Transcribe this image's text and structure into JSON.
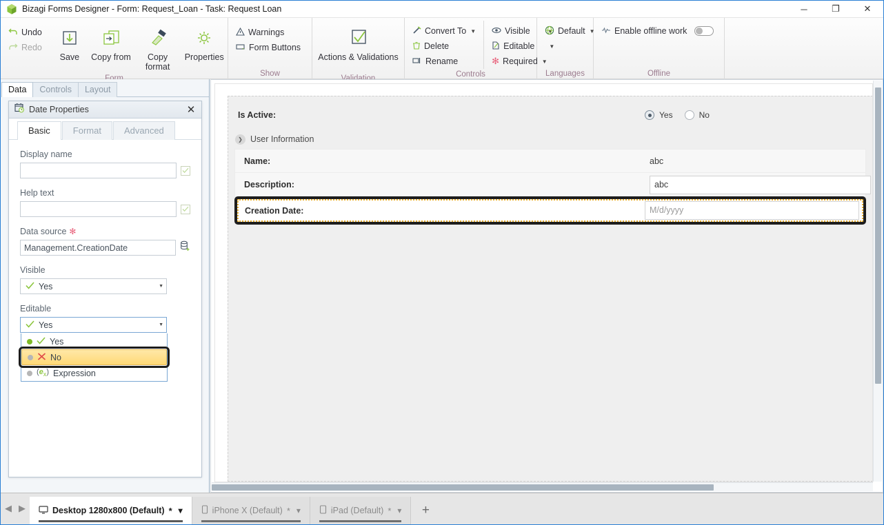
{
  "window": {
    "title": "Bizagi Forms Designer  - Form: Request_Loan - Task:  Request Loan",
    "logo_icon": "bizagi-cube-icon",
    "minimize_label": "─",
    "maximize_label": "❐",
    "close_label": "✕"
  },
  "ribbon": {
    "groups": [
      {
        "label": "Form",
        "small_commands": [
          {
            "label": "Undo",
            "icon": "undo-icon",
            "disabled": false
          },
          {
            "label": "Redo",
            "icon": "redo-icon",
            "disabled": true
          }
        ],
        "big_commands": [
          {
            "label": "Save",
            "icon": "save-icon"
          },
          {
            "label": "Copy from",
            "icon": "copy-from-icon"
          },
          {
            "label": "Copy format",
            "icon": "copy-format-icon"
          },
          {
            "label": "Properties",
            "icon": "gear-icon"
          }
        ]
      },
      {
        "label": "Show",
        "small_commands": [
          {
            "label": "Warnings",
            "icon": "warning-triangle-icon"
          },
          {
            "label": "Form Buttons",
            "icon": "form-buttons-icon"
          }
        ]
      },
      {
        "label": "Validation",
        "big_commands": [
          {
            "label": "Actions & Validations",
            "icon": "checkmark-box-icon"
          }
        ]
      },
      {
        "label": "Controls",
        "small_commands": [
          {
            "label": "Convert To",
            "icon": "convert-to-icon",
            "caret": true
          },
          {
            "label": "Delete",
            "icon": "trash-icon",
            "caret": false
          },
          {
            "label": "Rename",
            "icon": "rename-icon",
            "caret": false
          }
        ],
        "small_commands_2": [
          {
            "label": "Visible",
            "icon": "eye-icon",
            "caret": true
          },
          {
            "label": "Editable",
            "icon": "editable-icon",
            "caret": true
          },
          {
            "label": "Required",
            "icon": "asterisk-icon",
            "caret": true
          }
        ]
      },
      {
        "label": "Languages",
        "small_commands": [
          {
            "label": "Default",
            "icon": "globe-icon",
            "caret": true
          }
        ]
      },
      {
        "label": "Offline",
        "small_commands": [
          {
            "label": "Enable offline work",
            "icon": "offline-icon",
            "toggle": true
          }
        ]
      }
    ]
  },
  "left_panel": {
    "tabs": [
      {
        "label": "Data",
        "active": true
      },
      {
        "label": "Controls",
        "active": false
      },
      {
        "label": "Layout",
        "active": false
      }
    ],
    "dialog": {
      "icon": "calendar-clock-icon",
      "title": "Date Properties",
      "close_label": "✕",
      "tabs": [
        {
          "label": "Basic",
          "active": true
        },
        {
          "label": "Format",
          "active": false
        },
        {
          "label": "Advanced",
          "active": false
        }
      ],
      "fields": {
        "display_name_label": "Display name",
        "display_name_value": "",
        "help_text_label": "Help text",
        "help_text_value": "",
        "data_source_label": "Data source",
        "data_source_required_mark": "✻",
        "data_source_value": "Management.CreationDate",
        "data_source_button_icon": "database-add-icon",
        "visible_label": "Visible",
        "visible_value": "Yes",
        "editable_label": "Editable",
        "editable_value": "Yes"
      },
      "editable_dropdown": {
        "open": true,
        "options": [
          {
            "label": "Yes",
            "icon": "green-check-icon",
            "selected": true,
            "highlighted": false
          },
          {
            "label": "No",
            "icon": "red-x-icon",
            "selected": false,
            "highlighted": true
          },
          {
            "label": "Expression",
            "icon": "expression-icon",
            "selected": false,
            "highlighted": false
          }
        ]
      }
    }
  },
  "canvas": {
    "is_active_row": {
      "label": "Is Active:",
      "options": [
        {
          "label": "Yes",
          "selected": true
        },
        {
          "label": "No",
          "selected": false
        }
      ]
    },
    "section": {
      "title": "User Information",
      "collapse_icon": "chevron-down-icon",
      "rows": [
        {
          "label": "Name:",
          "value": "abc",
          "type": "text",
          "selected": false
        },
        {
          "label": "Description:",
          "value": "abc",
          "type": "input",
          "selected": false
        },
        {
          "label": "Creation Date:",
          "value": "M/d/yyyy",
          "type": "input-placeholder",
          "selected": true
        }
      ]
    }
  },
  "bottom_bar": {
    "prev_icon": "triangle-left-icon",
    "next_icon": "triangle-right-icon",
    "add_label": "+",
    "tabs": [
      {
        "label": "Desktop 1280x800 (Default)",
        "modified": "*",
        "icon": "monitor-icon",
        "active": true,
        "caret": "⌄"
      },
      {
        "label": "iPhone X (Default)",
        "modified": "*",
        "icon": "phone-icon",
        "active": false,
        "caret": "⌄"
      },
      {
        "label": "iPad (Default)",
        "modified": "*",
        "icon": "tablet-icon",
        "active": false,
        "caret": "⌄"
      }
    ]
  },
  "colors": {
    "accent_green": "#7fba27",
    "highlight_yellow": "#ffd976",
    "selection_outline": "#1d1d1d",
    "dotted_orange": "#e8ae2e",
    "window_border": "#2a7fd4"
  }
}
